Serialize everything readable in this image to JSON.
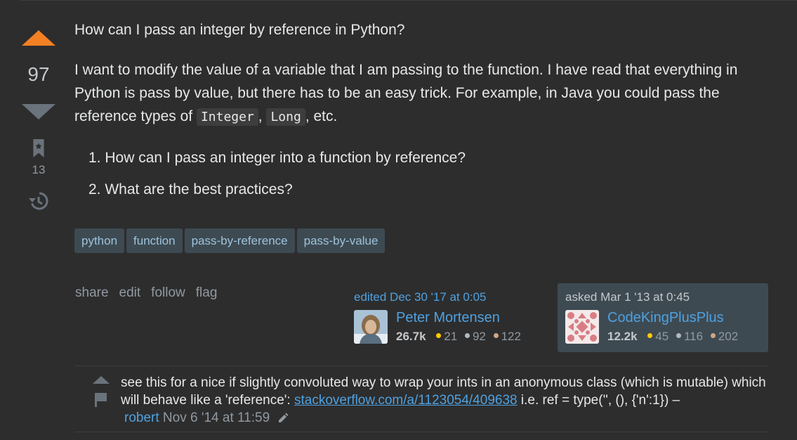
{
  "question": {
    "votes": "97",
    "bookmarks": "13",
    "title_line": "How can I pass an integer by reference in Python?",
    "body_text_1": "I want to modify the value of a variable that I am passing to the function. I have read that everything in Python is pass by value, but there has to be an easy trick. For example, in Java you could pass the reference types of ",
    "code_1": "Integer",
    "sep_1": ", ",
    "code_2": "Long",
    "body_text_2": ", etc.",
    "list": [
      "How can I pass an integer into a function by reference?",
      "What are the best practices?"
    ],
    "list_numbers": [
      "1.",
      "2."
    ]
  },
  "tags": [
    "python",
    "function",
    "pass-by-reference",
    "pass-by-value"
  ],
  "post_menu": {
    "share": "share",
    "edit": "edit",
    "follow": "follow",
    "flag": "flag"
  },
  "edited": {
    "action": "edited Dec 30 '17 at 0:05",
    "user": "Peter Mortensen",
    "reputation": "26.7k",
    "gold": "21",
    "silver": "92",
    "bronze": "122"
  },
  "asked": {
    "action": "asked Mar 1 '13 at 0:45",
    "user": "CodeKingPlusPlus",
    "reputation": "12.2k",
    "gold": "45",
    "silver": "116",
    "bronze": "202"
  },
  "comment": {
    "text_1": "see this for a nice if slightly convoluted way to wrap your ints in an anonymous class (which is mutable) which will behave like a 'reference': ",
    "link": "stackoverflow.com/a/1123054/409638",
    "text_2": " i.e. ref = type('', (), {'n':1}) – ",
    "author": "robert",
    "date": "Nov 6 '14 at 11:59"
  },
  "colors": {
    "background": "#2d2d2d",
    "accent_orange": "#f48024",
    "link_blue": "#4fa1e0",
    "tag_bg": "#3e4a52",
    "tag_text": "#9cc3db"
  },
  "icons": [
    "upvote-icon",
    "downvote-icon",
    "bookmark-icon",
    "history-icon",
    "comment-upvote-icon",
    "comment-flag-icon",
    "pencil-icon"
  ]
}
